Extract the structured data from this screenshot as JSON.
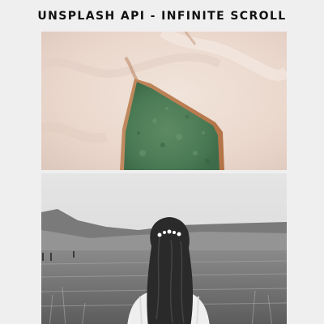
{
  "header": {
    "title": "UNSPLASH API - INFINITE SCROLL"
  },
  "feed": {
    "photos": [
      {
        "subject": "aerial-green-landform-photo"
      },
      {
        "subject": "woman-in-field-bw-photo"
      }
    ]
  },
  "colors": {
    "background": "#f0eff0",
    "title": "#111111"
  }
}
